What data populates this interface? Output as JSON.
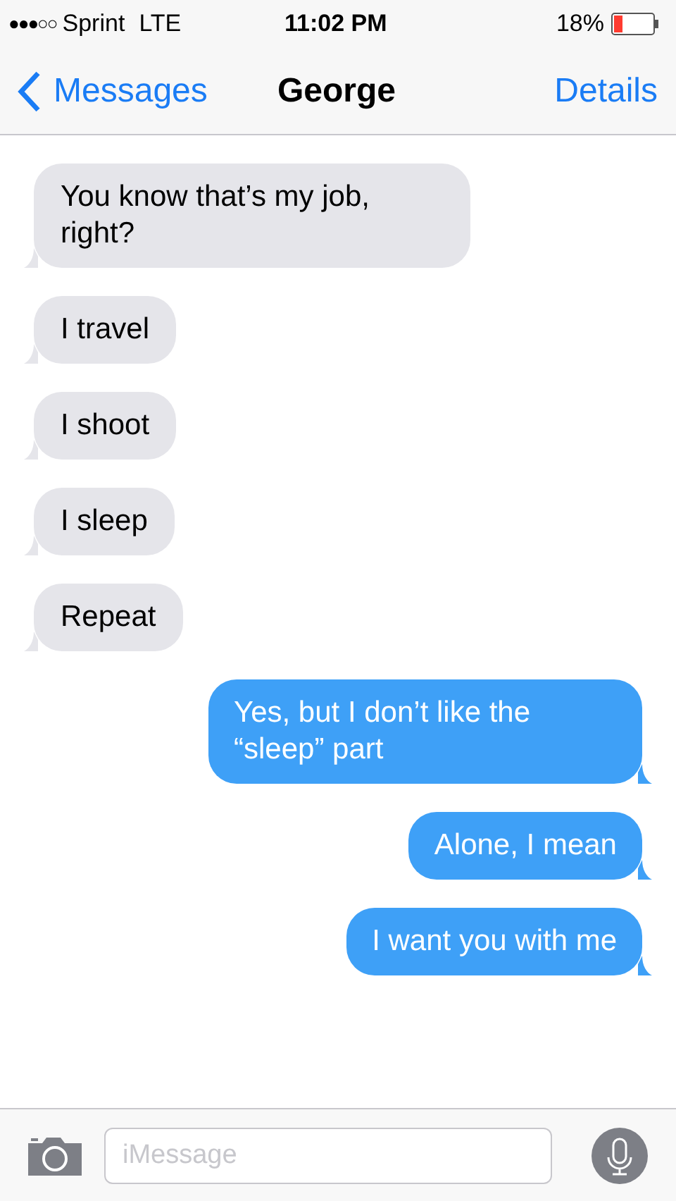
{
  "status_bar": {
    "signal": "●●●○○",
    "carrier": "Sprint",
    "network": "LTE",
    "time": "11:02 PM",
    "battery": "18%"
  },
  "nav": {
    "back": "Messages",
    "title": "George",
    "action": "Details"
  },
  "messages": [
    {
      "kind": "received",
      "text": "You know that’s my job, right?"
    },
    {
      "kind": "received",
      "text": "I travel"
    },
    {
      "kind": "received",
      "text": "I shoot"
    },
    {
      "kind": "received",
      "text": "I sleep"
    },
    {
      "kind": "received",
      "text": "Repeat"
    },
    {
      "kind": "sent",
      "text": "Yes, but I don’t like the “sleep” part"
    },
    {
      "kind": "sent",
      "text": "Alone, I mean"
    },
    {
      "kind": "sent",
      "text": "I want you with me"
    }
  ],
  "composer": {
    "placeholder": "iMessage"
  }
}
